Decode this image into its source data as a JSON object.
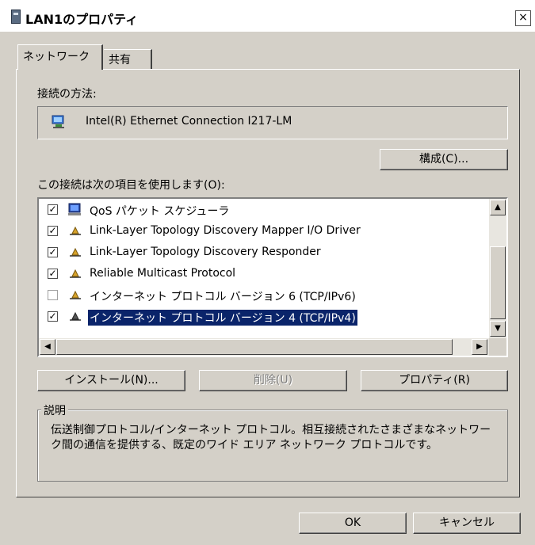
{
  "window": {
    "title": "LAN1のプロパティ",
    "close_glyph": "×"
  },
  "tabs": [
    {
      "label": "ネットワーク"
    },
    {
      "label": "共有"
    }
  ],
  "connect_using": {
    "label": "接続の方法:",
    "adapter": "Intel(R) Ethernet Connection I217-LM",
    "configure_button": "構成(C)..."
  },
  "items_section": {
    "label": "この接続は次の項目を使用します(O):",
    "items": [
      {
        "label": "QoS パケット スケジューラ",
        "checked": true,
        "icon": "network-monitor-icon"
      },
      {
        "label": "Link-Layer Topology Discovery Mapper I/O Driver",
        "checked": true,
        "icon": "protocol-icon"
      },
      {
        "label": "Link-Layer Topology Discovery Responder",
        "checked": true,
        "icon": "protocol-icon"
      },
      {
        "label": "Reliable Multicast Protocol",
        "checked": true,
        "icon": "protocol-icon"
      },
      {
        "label": "インターネット プロトコル バージョン 6 (TCP/IPv6)",
        "checked": false,
        "icon": "protocol-icon"
      },
      {
        "label": "インターネット プロトコル バージョン 4 (TCP/IPv4)",
        "checked": true,
        "icon": "protocol-icon",
        "selected": true
      }
    ]
  },
  "buttons": {
    "install": "インストール(N)...",
    "uninstall": "削除(U)",
    "properties": "プロパティ(R)",
    "ok": "OK",
    "cancel": "キャンセル"
  },
  "description": {
    "title": "説明",
    "text": "伝送制御プロトコル/インターネット プロトコル。相互接続されたさまざまなネットワーク間の通信を提供する、既定のワイド エリア ネットワーク プロトコルです。"
  },
  "colors": {
    "selection": "#0a246a",
    "face": "#d4d0c8"
  }
}
